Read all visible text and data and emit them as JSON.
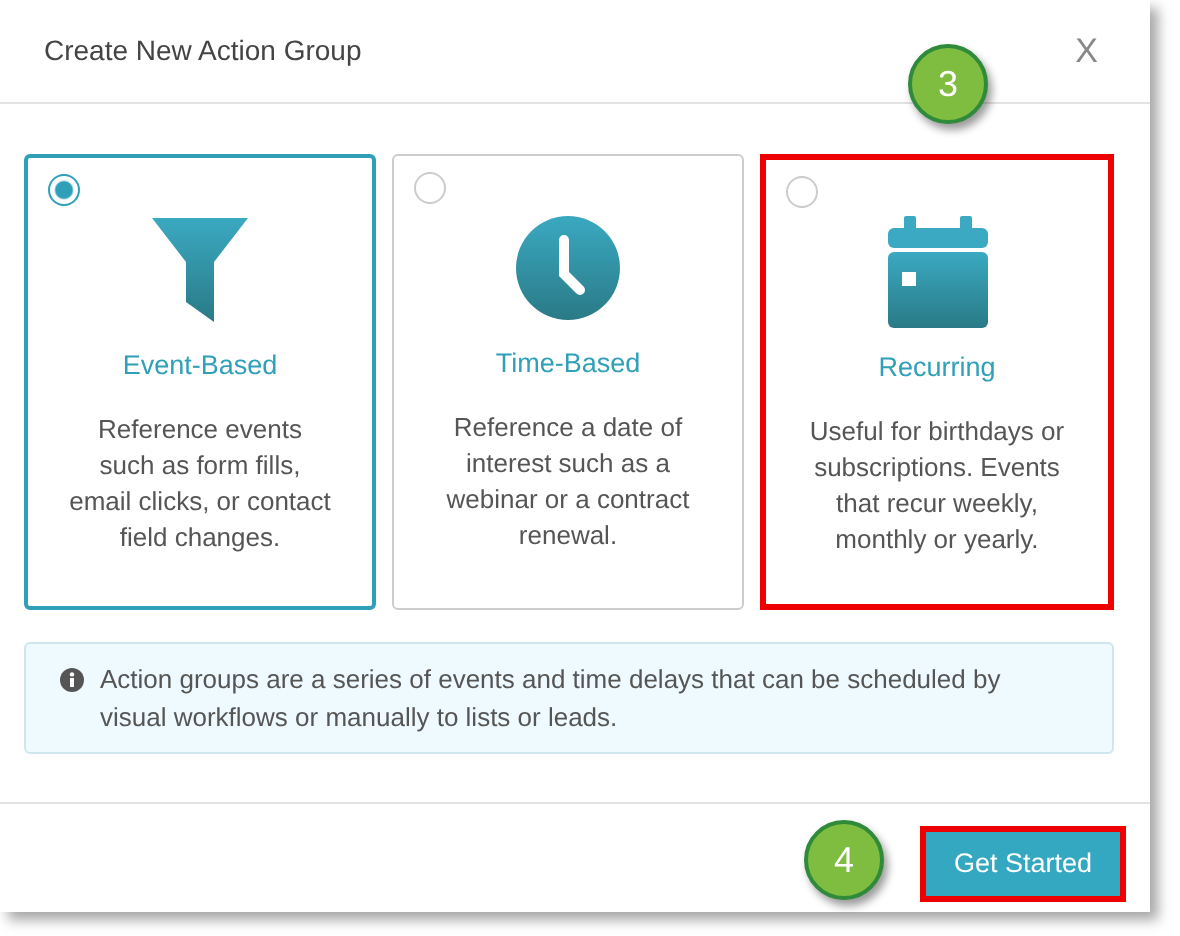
{
  "dialog": {
    "title": "Create New Action Group",
    "close": "X"
  },
  "options": [
    {
      "kind": "funnel",
      "label": "Event-Based",
      "description": "Reference events such as form fills, email clicks, or contact field changes.",
      "selected": true,
      "highlighted": false
    },
    {
      "kind": "clock",
      "label": "Time-Based",
      "description": "Reference a date of interest such as a webinar or a contract renewal.",
      "selected": false,
      "highlighted": false
    },
    {
      "kind": "calendar",
      "label": "Recurring",
      "description": "Useful for birthdays or subscriptions. Events that recur weekly, monthly or yearly.",
      "selected": false,
      "highlighted": true
    }
  ],
  "info": "Action groups are a series of events and time delays that can be scheduled by visual workflows or manually to lists or leads.",
  "primary_button": {
    "label": "Get Started",
    "highlighted": true
  },
  "callouts": [
    {
      "label": "3"
    },
    {
      "label": "4"
    }
  ]
}
